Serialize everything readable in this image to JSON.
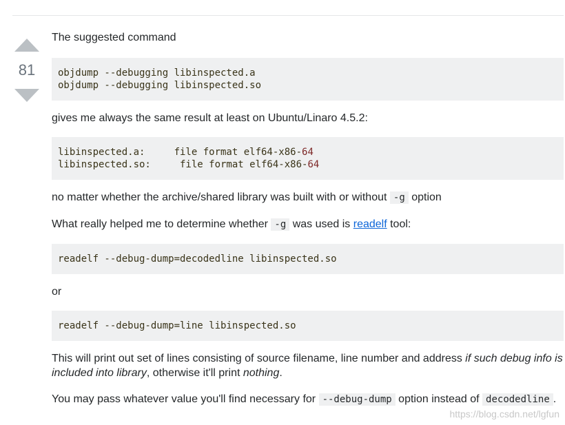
{
  "vote": {
    "count": "81"
  },
  "post": {
    "p1": "The suggested command",
    "code1": {
      "line1": "objdump --debugging libinspected.a",
      "line2": "objdump --debugging libinspected.so"
    },
    "p2": "gives me always the same result at least on Ubuntu/Linaro 4.5.2:",
    "code2": {
      "line1_prefix": "libinspected.a:     file format elf64-x86-",
      "line1_num": "64",
      "line2_prefix": "libinspected.so:     file format elf64-x86-",
      "line2_num": "64"
    },
    "p3": {
      "text_before": "no matter whether the archive/shared library was built with or without ",
      "code": "-g",
      "text_after": " option"
    },
    "p4": {
      "text_before": "What really helped me to determine whether ",
      "code": "-g",
      "text_mid": " was used is ",
      "link": "readelf",
      "text_after": " tool:"
    },
    "code3": "readelf --debug-dump=decodedline libinspected.so",
    "p5": "or",
    "code4": "readelf --debug-dump=line libinspected.so",
    "p6": {
      "text_before": "This will print out set of lines consisting of source filename, line number and address ",
      "em1": "if such debug info is included into library",
      "text_mid": ", otherwise it'll print ",
      "em2": "nothing",
      "text_after": "."
    },
    "p7": {
      "text_before": "You may pass whatever value you'll find necessary for ",
      "code1": "--debug-dump",
      "text_mid": " option instead of ",
      "code2": "decodedline",
      "text_after": "."
    }
  },
  "watermark": "https://blog.csdn.net/lgfun"
}
